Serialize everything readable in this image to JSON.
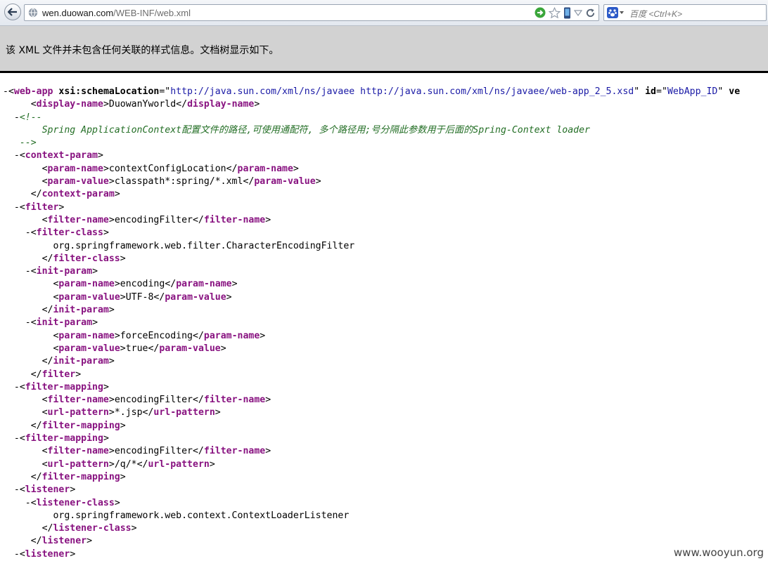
{
  "toolbar": {
    "url_host": "wen.duowan.com",
    "url_path": "/WEB-INF/web.xml",
    "search_placeholder": "百度 <Ctrl+K>"
  },
  "colors": {
    "tag": "#881280",
    "attr_value": "#1a1aa6",
    "comment": "#236e25"
  },
  "notice": "该 XML 文件并未包含任何关联的样式信息。文档树显示如下。",
  "xml_lines": [
    {
      "i": 0,
      "m": "-",
      "s": [
        [
          "mk",
          "<"
        ],
        [
          "tg",
          "web-app"
        ],
        [
          "at",
          " xsi:schemaLocation"
        ],
        [
          "mk",
          "=\""
        ],
        [
          "av",
          "http://java.sun.com/xml/ns/javaee http://java.sun.com/xml/ns/javaee/web-app_2_5.xsd"
        ],
        [
          "mk",
          "\" "
        ],
        [
          "at",
          "id"
        ],
        [
          "mk",
          "=\""
        ],
        [
          "av",
          "WebApp_ID"
        ],
        [
          "mk",
          "\" "
        ],
        [
          "at",
          "ve"
        ]
      ]
    },
    {
      "i": 2,
      "m": "",
      "s": [
        [
          "mk",
          "<"
        ],
        [
          "tg",
          "display-name"
        ],
        [
          "mk",
          ">"
        ],
        [
          "tx",
          "DuowanYworld"
        ],
        [
          "mk",
          "</"
        ],
        [
          "tg",
          "display-name"
        ],
        [
          "mk",
          ">"
        ]
      ]
    },
    {
      "i": 1,
      "m": "-",
      "s": [
        [
          "cm",
          "<!--"
        ]
      ]
    },
    {
      "i": 3,
      "m": "",
      "s": [
        [
          "cm",
          "Spring ApplicationContext配置文件的路径,可使用通配符, 多个路径用;号分隔此参数用于后面的Spring-Context loader"
        ]
      ]
    },
    {
      "i": 1,
      "m": "",
      "s": [
        [
          "cm",
          "-->"
        ]
      ]
    },
    {
      "i": 1,
      "m": "-",
      "s": [
        [
          "mk",
          "<"
        ],
        [
          "tg",
          "context-param"
        ],
        [
          "mk",
          ">"
        ]
      ]
    },
    {
      "i": 3,
      "m": "",
      "s": [
        [
          "mk",
          "<"
        ],
        [
          "tg",
          "param-name"
        ],
        [
          "mk",
          ">"
        ],
        [
          "tx",
          "contextConfigLocation"
        ],
        [
          "mk",
          "</"
        ],
        [
          "tg",
          "param-name"
        ],
        [
          "mk",
          ">"
        ]
      ]
    },
    {
      "i": 3,
      "m": "",
      "s": [
        [
          "mk",
          "<"
        ],
        [
          "tg",
          "param-value"
        ],
        [
          "mk",
          ">"
        ],
        [
          "tx",
          "classpath*:spring/*.xml"
        ],
        [
          "mk",
          "</"
        ],
        [
          "tg",
          "param-value"
        ],
        [
          "mk",
          ">"
        ]
      ]
    },
    {
      "i": 2,
      "m": "",
      "s": [
        [
          "mk",
          "</"
        ],
        [
          "tg",
          "context-param"
        ],
        [
          "mk",
          ">"
        ]
      ]
    },
    {
      "i": 1,
      "m": "-",
      "s": [
        [
          "mk",
          "<"
        ],
        [
          "tg",
          "filter"
        ],
        [
          "mk",
          ">"
        ]
      ]
    },
    {
      "i": 3,
      "m": "",
      "s": [
        [
          "mk",
          "<"
        ],
        [
          "tg",
          "filter-name"
        ],
        [
          "mk",
          ">"
        ],
        [
          "tx",
          "encodingFilter"
        ],
        [
          "mk",
          "</"
        ],
        [
          "tg",
          "filter-name"
        ],
        [
          "mk",
          ">"
        ]
      ]
    },
    {
      "i": 2,
      "m": "-",
      "s": [
        [
          "mk",
          "<"
        ],
        [
          "tg",
          "filter-class"
        ],
        [
          "mk",
          ">"
        ]
      ]
    },
    {
      "i": 4,
      "m": "",
      "s": [
        [
          "tx",
          "org.springframework.web.filter.CharacterEncodingFilter"
        ]
      ]
    },
    {
      "i": 3,
      "m": "",
      "s": [
        [
          "mk",
          "</"
        ],
        [
          "tg",
          "filter-class"
        ],
        [
          "mk",
          ">"
        ]
      ]
    },
    {
      "i": 2,
      "m": "-",
      "s": [
        [
          "mk",
          "<"
        ],
        [
          "tg",
          "init-param"
        ],
        [
          "mk",
          ">"
        ]
      ]
    },
    {
      "i": 4,
      "m": "",
      "s": [
        [
          "mk",
          "<"
        ],
        [
          "tg",
          "param-name"
        ],
        [
          "mk",
          ">"
        ],
        [
          "tx",
          "encoding"
        ],
        [
          "mk",
          "</"
        ],
        [
          "tg",
          "param-name"
        ],
        [
          "mk",
          ">"
        ]
      ]
    },
    {
      "i": 4,
      "m": "",
      "s": [
        [
          "mk",
          "<"
        ],
        [
          "tg",
          "param-value"
        ],
        [
          "mk",
          ">"
        ],
        [
          "tx",
          "UTF-8"
        ],
        [
          "mk",
          "</"
        ],
        [
          "tg",
          "param-value"
        ],
        [
          "mk",
          ">"
        ]
      ]
    },
    {
      "i": 3,
      "m": "",
      "s": [
        [
          "mk",
          "</"
        ],
        [
          "tg",
          "init-param"
        ],
        [
          "mk",
          ">"
        ]
      ]
    },
    {
      "i": 2,
      "m": "-",
      "s": [
        [
          "mk",
          "<"
        ],
        [
          "tg",
          "init-param"
        ],
        [
          "mk",
          ">"
        ]
      ]
    },
    {
      "i": 4,
      "m": "",
      "s": [
        [
          "mk",
          "<"
        ],
        [
          "tg",
          "param-name"
        ],
        [
          "mk",
          ">"
        ],
        [
          "tx",
          "forceEncoding"
        ],
        [
          "mk",
          "</"
        ],
        [
          "tg",
          "param-name"
        ],
        [
          "mk",
          ">"
        ]
      ]
    },
    {
      "i": 4,
      "m": "",
      "s": [
        [
          "mk",
          "<"
        ],
        [
          "tg",
          "param-value"
        ],
        [
          "mk",
          ">"
        ],
        [
          "tx",
          "true"
        ],
        [
          "mk",
          "</"
        ],
        [
          "tg",
          "param-value"
        ],
        [
          "mk",
          ">"
        ]
      ]
    },
    {
      "i": 3,
      "m": "",
      "s": [
        [
          "mk",
          "</"
        ],
        [
          "tg",
          "init-param"
        ],
        [
          "mk",
          ">"
        ]
      ]
    },
    {
      "i": 2,
      "m": "",
      "s": [
        [
          "mk",
          "</"
        ],
        [
          "tg",
          "filter"
        ],
        [
          "mk",
          ">"
        ]
      ]
    },
    {
      "i": 1,
      "m": "-",
      "s": [
        [
          "mk",
          "<"
        ],
        [
          "tg",
          "filter-mapping"
        ],
        [
          "mk",
          ">"
        ]
      ]
    },
    {
      "i": 3,
      "m": "",
      "s": [
        [
          "mk",
          "<"
        ],
        [
          "tg",
          "filter-name"
        ],
        [
          "mk",
          ">"
        ],
        [
          "tx",
          "encodingFilter"
        ],
        [
          "mk",
          "</"
        ],
        [
          "tg",
          "filter-name"
        ],
        [
          "mk",
          ">"
        ]
      ]
    },
    {
      "i": 3,
      "m": "",
      "s": [
        [
          "mk",
          "<"
        ],
        [
          "tg",
          "url-pattern"
        ],
        [
          "mk",
          ">"
        ],
        [
          "tx",
          "*.jsp"
        ],
        [
          "mk",
          "</"
        ],
        [
          "tg",
          "url-pattern"
        ],
        [
          "mk",
          ">"
        ]
      ]
    },
    {
      "i": 2,
      "m": "",
      "s": [
        [
          "mk",
          "</"
        ],
        [
          "tg",
          "filter-mapping"
        ],
        [
          "mk",
          ">"
        ]
      ]
    },
    {
      "i": 1,
      "m": "-",
      "s": [
        [
          "mk",
          "<"
        ],
        [
          "tg",
          "filter-mapping"
        ],
        [
          "mk",
          ">"
        ]
      ]
    },
    {
      "i": 3,
      "m": "",
      "s": [
        [
          "mk",
          "<"
        ],
        [
          "tg",
          "filter-name"
        ],
        [
          "mk",
          ">"
        ],
        [
          "tx",
          "encodingFilter"
        ],
        [
          "mk",
          "</"
        ],
        [
          "tg",
          "filter-name"
        ],
        [
          "mk",
          ">"
        ]
      ]
    },
    {
      "i": 3,
      "m": "",
      "s": [
        [
          "mk",
          "<"
        ],
        [
          "tg",
          "url-pattern"
        ],
        [
          "mk",
          ">"
        ],
        [
          "tx",
          "/q/*"
        ],
        [
          "mk",
          "</"
        ],
        [
          "tg",
          "url-pattern"
        ],
        [
          "mk",
          ">"
        ]
      ]
    },
    {
      "i": 2,
      "m": "",
      "s": [
        [
          "mk",
          "</"
        ],
        [
          "tg",
          "filter-mapping"
        ],
        [
          "mk",
          ">"
        ]
      ]
    },
    {
      "i": 1,
      "m": "-",
      "s": [
        [
          "mk",
          "<"
        ],
        [
          "tg",
          "listener"
        ],
        [
          "mk",
          ">"
        ]
      ]
    },
    {
      "i": 2,
      "m": "-",
      "s": [
        [
          "mk",
          "<"
        ],
        [
          "tg",
          "listener-class"
        ],
        [
          "mk",
          ">"
        ]
      ]
    },
    {
      "i": 4,
      "m": "",
      "s": [
        [
          "tx",
          "org.springframework.web.context.ContextLoaderListener"
        ]
      ]
    },
    {
      "i": 3,
      "m": "",
      "s": [
        [
          "mk",
          "</"
        ],
        [
          "tg",
          "listener-class"
        ],
        [
          "mk",
          ">"
        ]
      ]
    },
    {
      "i": 2,
      "m": "",
      "s": [
        [
          "mk",
          "</"
        ],
        [
          "tg",
          "listener"
        ],
        [
          "mk",
          ">"
        ]
      ]
    },
    {
      "i": 1,
      "m": "-",
      "s": [
        [
          "mk",
          "<"
        ],
        [
          "tg",
          "listener"
        ],
        [
          "mk",
          ">"
        ]
      ]
    }
  ],
  "watermark": "www.wooyun.org"
}
